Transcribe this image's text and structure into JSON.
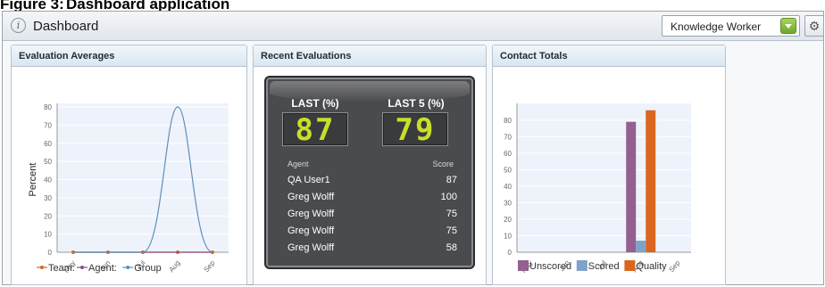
{
  "caption": {
    "number": "Figure 3:",
    "title": "Dashboard application"
  },
  "header": {
    "title": "Dashboard",
    "info_icon": "info-icon",
    "settings_icon": "gear-icon"
  },
  "role_select": {
    "value": "Knowledge Worker"
  },
  "colors": {
    "team": "#d9661f",
    "agent": "#8c4f84",
    "group": "#5b8fbd",
    "unscored": "#94608f",
    "scored": "#7ea3c9",
    "quality": "#d9661f",
    "digits": "#c8df2a"
  },
  "panels": [
    {
      "title": "Evaluation Averages",
      "chart_data": {
        "type": "line",
        "categories": [
          "May",
          "Jun",
          "Jul",
          "Aug",
          "Sep"
        ],
        "series": [
          {
            "name": "Team",
            "values": [
              0,
              0,
              0,
              0,
              0
            ]
          },
          {
            "name": "Agent",
            "values": [
              0,
              0,
              0,
              0,
              0
            ]
          },
          {
            "name": "Group",
            "values": [
              0,
              0,
              0,
              80,
              0
            ]
          }
        ],
        "ylabel": "Percent",
        "ylim": [
          0,
          80
        ],
        "yticks": [
          0,
          10,
          20,
          30,
          40,
          50,
          60,
          70,
          80
        ],
        "grid": true,
        "legend_position": "bottom",
        "legend_labels": [
          "Team:",
          "Agent:",
          "Group"
        ]
      }
    },
    {
      "title": "Recent Evaluations",
      "last_label": "LAST (%)",
      "last_value": "87",
      "last5_label": "LAST 5 (%)",
      "last5_value": "79",
      "col_agent": "Agent",
      "col_score": "Score",
      "rows": [
        {
          "agent": "QA User1",
          "score": "87"
        },
        {
          "agent": "Greg Wolff",
          "score": "100"
        },
        {
          "agent": "Greg Wolff",
          "score": "75"
        },
        {
          "agent": "Greg Wolff",
          "score": "75"
        },
        {
          "agent": "Greg Wolff",
          "score": "58"
        }
      ]
    },
    {
      "title": "Contact Totals",
      "chart_data": {
        "type": "bar",
        "categories": [
          "May",
          "Jun",
          "Jul",
          "Aug",
          "Sep"
        ],
        "series": [
          {
            "name": "Unscored",
            "values": [
              0,
              0,
              0,
              79,
              0
            ]
          },
          {
            "name": "Scored",
            "values": [
              0,
              0,
              0,
              7,
              0
            ]
          },
          {
            "name": "Quality",
            "values": [
              0,
              0,
              0,
              86,
              0
            ]
          }
        ],
        "ylim": [
          0,
          86
        ],
        "yticks": [
          0,
          10,
          20,
          30,
          40,
          50,
          60,
          70,
          80
        ],
        "grid": true,
        "legend_position": "bottom"
      }
    }
  ]
}
